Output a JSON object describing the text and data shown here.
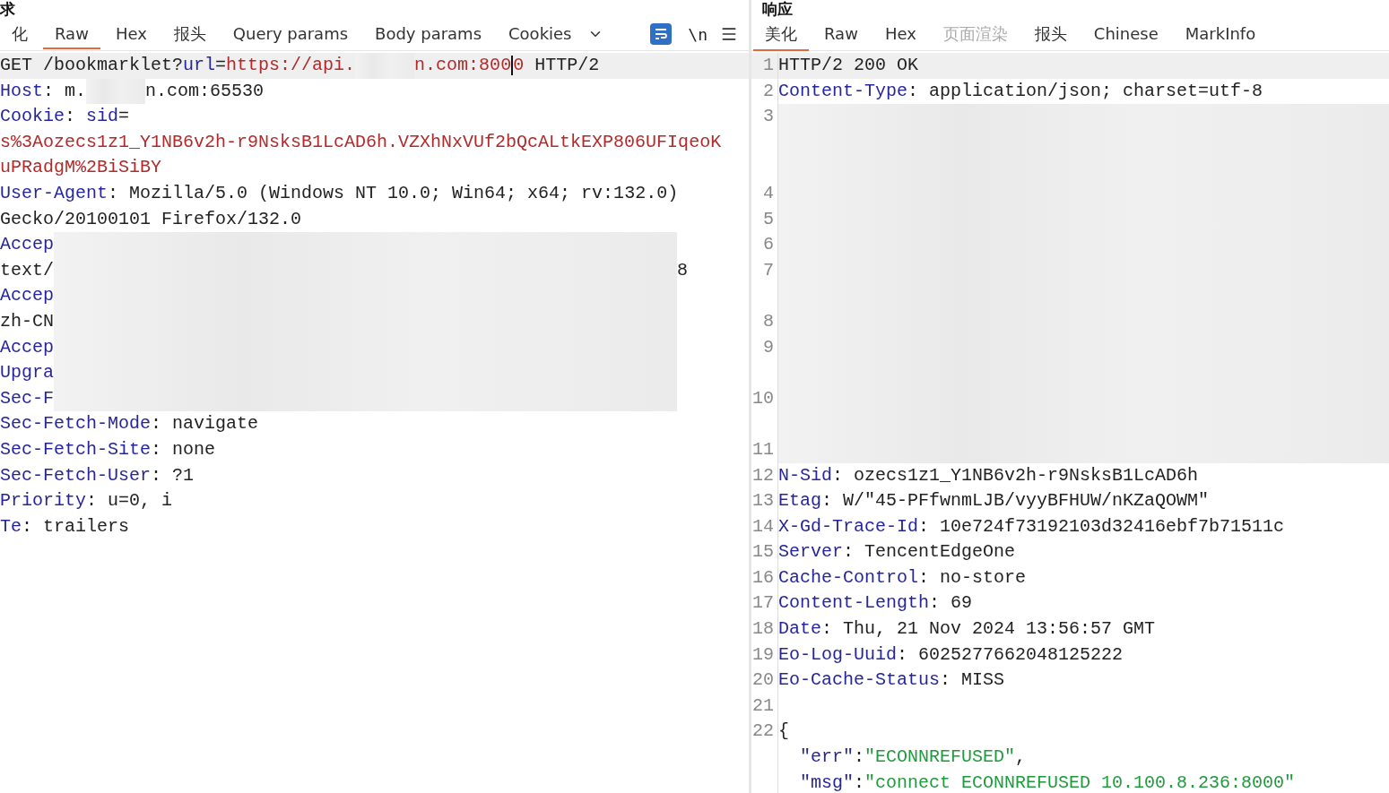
{
  "request": {
    "title": "求",
    "tabs": [
      {
        "label": "化",
        "selected": false,
        "disabled": false
      },
      {
        "label": "Raw",
        "selected": true,
        "disabled": false
      },
      {
        "label": "Hex",
        "selected": false,
        "disabled": false
      },
      {
        "label": "报头",
        "selected": false,
        "disabled": false
      },
      {
        "label": "Query params",
        "selected": false,
        "disabled": false
      },
      {
        "label": "Body params",
        "selected": false,
        "disabled": false
      },
      {
        "label": "Cookies",
        "selected": false,
        "disabled": false
      }
    ],
    "wrap_toggle": {
      "on": true
    },
    "newline_toggle": {
      "label": "\\n"
    },
    "lines": [
      {
        "current": true,
        "segments": [
          {
            "kind": "text",
            "text": "GET /bookmarklet?"
          },
          {
            "kind": "name",
            "text": "url"
          },
          {
            "kind": "text",
            "text": "="
          },
          {
            "kind": "url",
            "text": "https://api."
          },
          {
            "kind": "redacted-short"
          },
          {
            "kind": "url",
            "text": "n.com:800"
          },
          {
            "kind": "cursor"
          },
          {
            "kind": "url",
            "text": "0"
          },
          {
            "kind": "text",
            "text": " HTTP/2"
          }
        ]
      },
      {
        "current": false,
        "segments": [
          {
            "kind": "name",
            "text": "Host"
          },
          {
            "kind": "text",
            "text": ": m."
          },
          {
            "kind": "redacted-short"
          },
          {
            "kind": "text",
            "text": "n.com:65530"
          }
        ]
      },
      {
        "current": false,
        "segments": [
          {
            "kind": "name",
            "text": "Cookie"
          },
          {
            "kind": "text",
            "text": ": "
          },
          {
            "kind": "name",
            "text": "sid"
          },
          {
            "kind": "text",
            "text": "="
          }
        ]
      },
      {
        "current": false,
        "segments": [
          {
            "kind": "url",
            "text": "s%3Aozecs1z1_Y1NB6v2h-r9NsksB1LcAD6h.VZXhNxVUf2bQcALtkEXP806UFIqeoK"
          }
        ]
      },
      {
        "current": false,
        "segments": [
          {
            "kind": "url",
            "text": "uPRadgM%2BiSiBY"
          }
        ]
      },
      {
        "current": false,
        "segments": [
          {
            "kind": "name",
            "text": "User-Agent"
          },
          {
            "kind": "text",
            "text": ": Mozilla/5.0 (Windows NT 10.0; Win64; x64; rv:132.0)"
          }
        ]
      },
      {
        "current": false,
        "segments": [
          {
            "kind": "text",
            "text": "Gecko/20100101 Firefox/132.0"
          }
        ]
      },
      {
        "current": false,
        "segments": [
          {
            "kind": "name",
            "text": "Accep"
          },
          {
            "kind": "redacted-long"
          }
        ]
      },
      {
        "current": false,
        "segments": [
          {
            "kind": "text",
            "text": "text/"
          },
          {
            "kind": "redacted-long"
          },
          {
            "kind": "text",
            "text": "8"
          }
        ]
      },
      {
        "current": false,
        "segments": [
          {
            "kind": "name",
            "text": "Accep"
          },
          {
            "kind": "redacted-long"
          }
        ]
      },
      {
        "current": false,
        "segments": [
          {
            "kind": "text",
            "text": "zh-CN"
          },
          {
            "kind": "redacted-long"
          }
        ]
      },
      {
        "current": false,
        "segments": [
          {
            "kind": "name",
            "text": "Accep"
          },
          {
            "kind": "redacted-long"
          }
        ]
      },
      {
        "current": false,
        "segments": [
          {
            "kind": "name",
            "text": "Upgra"
          },
          {
            "kind": "redacted-long"
          }
        ]
      },
      {
        "current": false,
        "segments": [
          {
            "kind": "name",
            "text": "Sec-F"
          },
          {
            "kind": "redacted-long"
          }
        ]
      },
      {
        "current": false,
        "segments": [
          {
            "kind": "name",
            "text": "Sec-Fetch-Mode"
          },
          {
            "kind": "text",
            "text": ": navigate"
          }
        ]
      },
      {
        "current": false,
        "segments": [
          {
            "kind": "name",
            "text": "Sec-Fetch-Site"
          },
          {
            "kind": "text",
            "text": ": none"
          }
        ]
      },
      {
        "current": false,
        "segments": [
          {
            "kind": "name",
            "text": "Sec-Fetch-User"
          },
          {
            "kind": "text",
            "text": ": ?1"
          }
        ]
      },
      {
        "current": false,
        "segments": [
          {
            "kind": "name",
            "text": "Priority"
          },
          {
            "kind": "text",
            "text": ": u=0, i"
          }
        ]
      },
      {
        "current": false,
        "segments": [
          {
            "kind": "name",
            "text": "Te"
          },
          {
            "kind": "text",
            "text": ": trailers"
          }
        ]
      }
    ]
  },
  "response": {
    "title": "响应",
    "tabs": [
      {
        "label": "美化",
        "selected": true,
        "disabled": false
      },
      {
        "label": "Raw",
        "selected": false,
        "disabled": false
      },
      {
        "label": "Hex",
        "selected": false,
        "disabled": false
      },
      {
        "label": "页面渲染",
        "selected": false,
        "disabled": true
      },
      {
        "label": "报头",
        "selected": false,
        "disabled": false
      },
      {
        "label": "Chinese",
        "selected": false,
        "disabled": false
      },
      {
        "label": "MarkInfo",
        "selected": false,
        "disabled": false
      }
    ],
    "lines": [
      {
        "number": "1",
        "current": true,
        "segments": [
          {
            "kind": "text",
            "text": "HTTP/2 200 OK"
          }
        ]
      },
      {
        "number": "2",
        "current": false,
        "segments": [
          {
            "kind": "name",
            "text": "Content-Type"
          },
          {
            "kind": "text",
            "text": ": application/json; charset=utf-8"
          }
        ]
      },
      {
        "number": "3",
        "current": false,
        "kind": "triple",
        "segments": [
          {
            "kind": "redacted-fill"
          }
        ]
      },
      {
        "number": "4",
        "current": false,
        "kind": "single",
        "segments": [
          {
            "kind": "redacted-fill"
          }
        ]
      },
      {
        "number": "5",
        "current": false,
        "kind": "single",
        "segments": [
          {
            "kind": "redacted-fill"
          }
        ]
      },
      {
        "number": "6",
        "current": false,
        "kind": "single",
        "segments": [
          {
            "kind": "redacted-fill"
          }
        ]
      },
      {
        "number": "7",
        "current": false,
        "kind": "double",
        "segments": [
          {
            "kind": "redacted-fill"
          }
        ]
      },
      {
        "number": "8",
        "current": false,
        "kind": "single",
        "segments": [
          {
            "kind": "redacted-fill"
          }
        ]
      },
      {
        "number": "9",
        "current": false,
        "kind": "double",
        "segments": [
          {
            "kind": "redacted-fill"
          }
        ]
      },
      {
        "number": "10",
        "current": false,
        "kind": "double",
        "segments": [
          {
            "kind": "redacted-fill"
          }
        ]
      },
      {
        "number": "11",
        "current": false,
        "kind": "single",
        "segments": [
          {
            "kind": "redacted-fill"
          }
        ]
      },
      {
        "number": "12",
        "current": false,
        "segments": [
          {
            "kind": "name",
            "text": "N-Sid"
          },
          {
            "kind": "text",
            "text": ": ozecs1z1_Y1NB6v2h-r9NsksB1LcAD6h"
          }
        ]
      },
      {
        "number": "13",
        "current": false,
        "segments": [
          {
            "kind": "name",
            "text": "Etag"
          },
          {
            "kind": "text",
            "text": ": W/\"45-PFfwnmLJB/vyyBFHUW/nKZaQOWM\""
          }
        ]
      },
      {
        "number": "14",
        "current": false,
        "segments": [
          {
            "kind": "name",
            "text": "X-Gd-Trace-Id"
          },
          {
            "kind": "text",
            "text": ": 10e724f73192103d32416ebf7b71511c"
          }
        ]
      },
      {
        "number": "15",
        "current": false,
        "segments": [
          {
            "kind": "name",
            "text": "Server"
          },
          {
            "kind": "text",
            "text": ": TencentEdgeOne"
          }
        ]
      },
      {
        "number": "16",
        "current": false,
        "segments": [
          {
            "kind": "name",
            "text": "Cache-Control"
          },
          {
            "kind": "text",
            "text": ": no-store"
          }
        ]
      },
      {
        "number": "17",
        "current": false,
        "segments": [
          {
            "kind": "name",
            "text": "Content-Length"
          },
          {
            "kind": "text",
            "text": ": 69"
          }
        ]
      },
      {
        "number": "18",
        "current": false,
        "segments": [
          {
            "kind": "name",
            "text": "Date"
          },
          {
            "kind": "text",
            "text": ": Thu, 21 Nov 2024 13:56:57 GMT"
          }
        ]
      },
      {
        "number": "19",
        "current": false,
        "segments": [
          {
            "kind": "name",
            "text": "Eo-Log-Uuid"
          },
          {
            "kind": "text",
            "text": ": 6025277662048125222"
          }
        ]
      },
      {
        "number": "20",
        "current": false,
        "segments": [
          {
            "kind": "name",
            "text": "Eo-Cache-Status"
          },
          {
            "kind": "text",
            "text": ": MISS"
          }
        ]
      },
      {
        "number": "21",
        "current": false
      },
      {
        "number": "22",
        "current": false,
        "segments": [
          {
            "kind": "text",
            "text": "{"
          }
        ]
      },
      {
        "current": false,
        "segments": [
          {
            "kind": "indent"
          },
          {
            "kind": "key",
            "text": "\"err\""
          },
          {
            "kind": "text",
            "text": ":"
          },
          {
            "kind": "string",
            "text": "\"ECONNREFUSED\""
          },
          {
            "kind": "text",
            "text": ","
          }
        ]
      },
      {
        "current": false,
        "segments": [
          {
            "kind": "indent"
          },
          {
            "kind": "key",
            "text": "\"msg\""
          },
          {
            "kind": "text",
            "text": ":"
          },
          {
            "kind": "string",
            "text": "\"connect ECONNREFUSED 10.100.8.236:8000\""
          }
        ]
      }
    ]
  }
}
